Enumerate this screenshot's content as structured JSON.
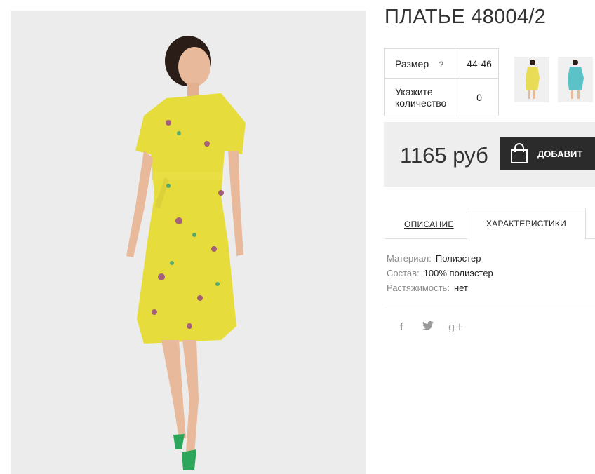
{
  "product": {
    "title": "ПЛАТЬЕ 48004/2",
    "main_image": "yellow-floral-dress-photo",
    "thumbnails": [
      {
        "name": "yellow-dress-thumbnail",
        "color": "#e8dc57"
      },
      {
        "name": "turquoise-dress-thumbnail",
        "color": "#5bc2c8"
      }
    ]
  },
  "options": {
    "size_label": "Размер",
    "size_help": "?",
    "size_value": "44-46",
    "qty_label_1": "Укажите",
    "qty_label_2": "количество",
    "qty_value": "0"
  },
  "purchase": {
    "price": "1165 руб",
    "cart_button": "ДОБАВИТ",
    "cart_icon": "shopping-bag-icon"
  },
  "tabs": [
    {
      "label": "ОПИСАНИЕ",
      "active": false
    },
    {
      "label": "ХАРАКТЕРИСТИКИ",
      "active": true
    }
  ],
  "specs": [
    {
      "key": "Материал:",
      "value": "Полиэстер"
    },
    {
      "key": "Состав:",
      "value": "100% полиэстер"
    },
    {
      "key": "Растяжимость:",
      "value": "нет"
    }
  ],
  "social": {
    "facebook": "f",
    "twitter_icon": "twitter-icon",
    "gplus": "g+"
  },
  "colors": {
    "dress": "#e6dc3c",
    "button": "#2b2b2b",
    "price_bg": "#eeeeee"
  }
}
